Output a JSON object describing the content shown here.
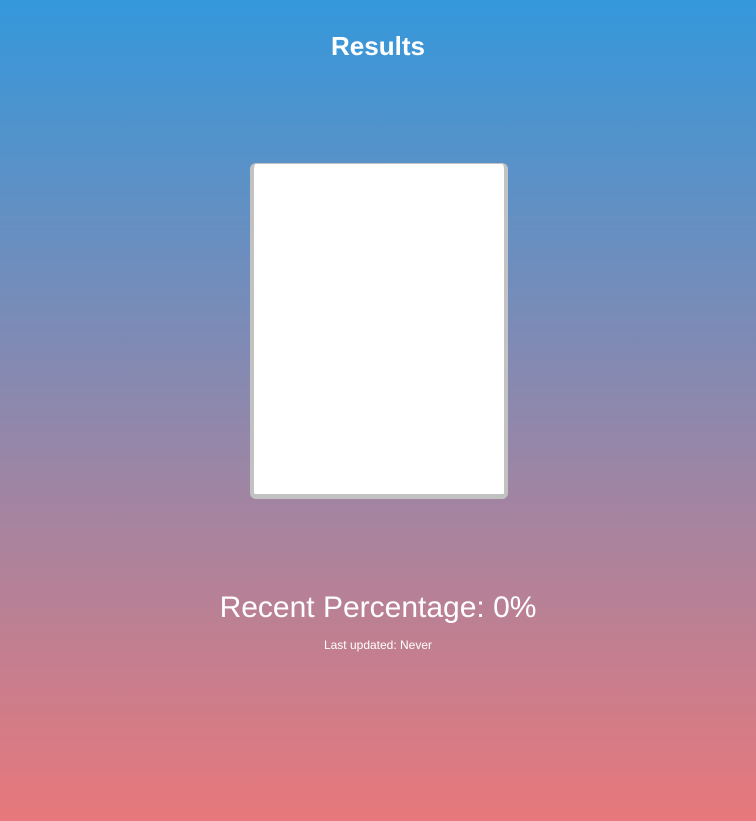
{
  "header": {
    "title": "Results"
  },
  "card": {
    "background_color": "#ffffff",
    "border_color": "#c2c2c2"
  },
  "stats": {
    "percentage_label": "Recent Percentage: ",
    "percentage_value": "0%",
    "last_updated_label": "Last updated: ",
    "last_updated_value": "Never"
  },
  "theme": {
    "gradient_top": "#3498db",
    "gradient_bottom": "#e8787b",
    "text_color": "#ffffff"
  }
}
